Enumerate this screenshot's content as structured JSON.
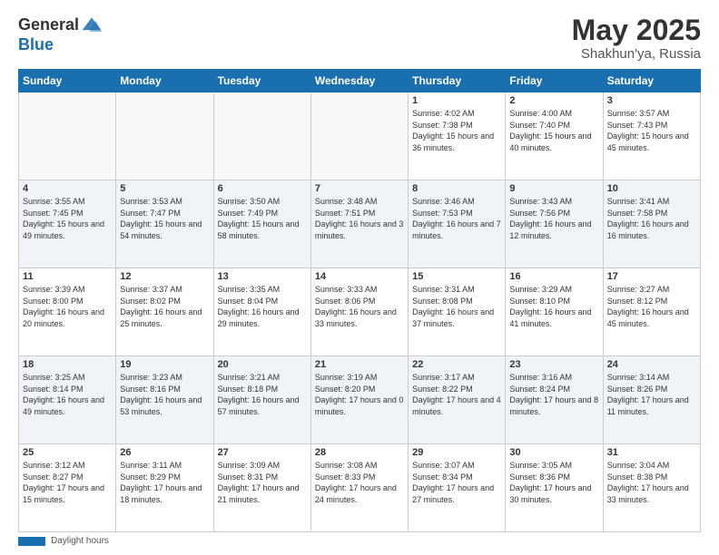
{
  "header": {
    "logo": {
      "general": "General",
      "blue": "Blue"
    },
    "title": "May 2025",
    "location": "Shakhun'ya, Russia"
  },
  "calendar": {
    "days_of_week": [
      "Sunday",
      "Monday",
      "Tuesday",
      "Wednesday",
      "Thursday",
      "Friday",
      "Saturday"
    ],
    "weeks": [
      [
        {
          "day": "",
          "sunrise": "",
          "sunset": "",
          "daylight": "",
          "empty": true
        },
        {
          "day": "",
          "sunrise": "",
          "sunset": "",
          "daylight": "",
          "empty": true
        },
        {
          "day": "",
          "sunrise": "",
          "sunset": "",
          "daylight": "",
          "empty": true
        },
        {
          "day": "",
          "sunrise": "",
          "sunset": "",
          "daylight": "",
          "empty": true
        },
        {
          "day": "1",
          "sunrise": "Sunrise: 4:02 AM",
          "sunset": "Sunset: 7:38 PM",
          "daylight": "Daylight: 15 hours and 36 minutes.",
          "empty": false
        },
        {
          "day": "2",
          "sunrise": "Sunrise: 4:00 AM",
          "sunset": "Sunset: 7:40 PM",
          "daylight": "Daylight: 15 hours and 40 minutes.",
          "empty": false
        },
        {
          "day": "3",
          "sunrise": "Sunrise: 3:57 AM",
          "sunset": "Sunset: 7:43 PM",
          "daylight": "Daylight: 15 hours and 45 minutes.",
          "empty": false
        }
      ],
      [
        {
          "day": "4",
          "sunrise": "Sunrise: 3:55 AM",
          "sunset": "Sunset: 7:45 PM",
          "daylight": "Daylight: 15 hours and 49 minutes.",
          "empty": false
        },
        {
          "day": "5",
          "sunrise": "Sunrise: 3:53 AM",
          "sunset": "Sunset: 7:47 PM",
          "daylight": "Daylight: 15 hours and 54 minutes.",
          "empty": false
        },
        {
          "day": "6",
          "sunrise": "Sunrise: 3:50 AM",
          "sunset": "Sunset: 7:49 PM",
          "daylight": "Daylight: 15 hours and 58 minutes.",
          "empty": false
        },
        {
          "day": "7",
          "sunrise": "Sunrise: 3:48 AM",
          "sunset": "Sunset: 7:51 PM",
          "daylight": "Daylight: 16 hours and 3 minutes.",
          "empty": false
        },
        {
          "day": "8",
          "sunrise": "Sunrise: 3:46 AM",
          "sunset": "Sunset: 7:53 PM",
          "daylight": "Daylight: 16 hours and 7 minutes.",
          "empty": false
        },
        {
          "day": "9",
          "sunrise": "Sunrise: 3:43 AM",
          "sunset": "Sunset: 7:56 PM",
          "daylight": "Daylight: 16 hours and 12 minutes.",
          "empty": false
        },
        {
          "day": "10",
          "sunrise": "Sunrise: 3:41 AM",
          "sunset": "Sunset: 7:58 PM",
          "daylight": "Daylight: 16 hours and 16 minutes.",
          "empty": false
        }
      ],
      [
        {
          "day": "11",
          "sunrise": "Sunrise: 3:39 AM",
          "sunset": "Sunset: 8:00 PM",
          "daylight": "Daylight: 16 hours and 20 minutes.",
          "empty": false
        },
        {
          "day": "12",
          "sunrise": "Sunrise: 3:37 AM",
          "sunset": "Sunset: 8:02 PM",
          "daylight": "Daylight: 16 hours and 25 minutes.",
          "empty": false
        },
        {
          "day": "13",
          "sunrise": "Sunrise: 3:35 AM",
          "sunset": "Sunset: 8:04 PM",
          "daylight": "Daylight: 16 hours and 29 minutes.",
          "empty": false
        },
        {
          "day": "14",
          "sunrise": "Sunrise: 3:33 AM",
          "sunset": "Sunset: 8:06 PM",
          "daylight": "Daylight: 16 hours and 33 minutes.",
          "empty": false
        },
        {
          "day": "15",
          "sunrise": "Sunrise: 3:31 AM",
          "sunset": "Sunset: 8:08 PM",
          "daylight": "Daylight: 16 hours and 37 minutes.",
          "empty": false
        },
        {
          "day": "16",
          "sunrise": "Sunrise: 3:29 AM",
          "sunset": "Sunset: 8:10 PM",
          "daylight": "Daylight: 16 hours and 41 minutes.",
          "empty": false
        },
        {
          "day": "17",
          "sunrise": "Sunrise: 3:27 AM",
          "sunset": "Sunset: 8:12 PM",
          "daylight": "Daylight: 16 hours and 45 minutes.",
          "empty": false
        }
      ],
      [
        {
          "day": "18",
          "sunrise": "Sunrise: 3:25 AM",
          "sunset": "Sunset: 8:14 PM",
          "daylight": "Daylight: 16 hours and 49 minutes.",
          "empty": false
        },
        {
          "day": "19",
          "sunrise": "Sunrise: 3:23 AM",
          "sunset": "Sunset: 8:16 PM",
          "daylight": "Daylight: 16 hours and 53 minutes.",
          "empty": false
        },
        {
          "day": "20",
          "sunrise": "Sunrise: 3:21 AM",
          "sunset": "Sunset: 8:18 PM",
          "daylight": "Daylight: 16 hours and 57 minutes.",
          "empty": false
        },
        {
          "day": "21",
          "sunrise": "Sunrise: 3:19 AM",
          "sunset": "Sunset: 8:20 PM",
          "daylight": "Daylight: 17 hours and 0 minutes.",
          "empty": false
        },
        {
          "day": "22",
          "sunrise": "Sunrise: 3:17 AM",
          "sunset": "Sunset: 8:22 PM",
          "daylight": "Daylight: 17 hours and 4 minutes.",
          "empty": false
        },
        {
          "day": "23",
          "sunrise": "Sunrise: 3:16 AM",
          "sunset": "Sunset: 8:24 PM",
          "daylight": "Daylight: 17 hours and 8 minutes.",
          "empty": false
        },
        {
          "day": "24",
          "sunrise": "Sunrise: 3:14 AM",
          "sunset": "Sunset: 8:26 PM",
          "daylight": "Daylight: 17 hours and 11 minutes.",
          "empty": false
        }
      ],
      [
        {
          "day": "25",
          "sunrise": "Sunrise: 3:12 AM",
          "sunset": "Sunset: 8:27 PM",
          "daylight": "Daylight: 17 hours and 15 minutes.",
          "empty": false
        },
        {
          "day": "26",
          "sunrise": "Sunrise: 3:11 AM",
          "sunset": "Sunset: 8:29 PM",
          "daylight": "Daylight: 17 hours and 18 minutes.",
          "empty": false
        },
        {
          "day": "27",
          "sunrise": "Sunrise: 3:09 AM",
          "sunset": "Sunset: 8:31 PM",
          "daylight": "Daylight: 17 hours and 21 minutes.",
          "empty": false
        },
        {
          "day": "28",
          "sunrise": "Sunrise: 3:08 AM",
          "sunset": "Sunset: 8:33 PM",
          "daylight": "Daylight: 17 hours and 24 minutes.",
          "empty": false
        },
        {
          "day": "29",
          "sunrise": "Sunrise: 3:07 AM",
          "sunset": "Sunset: 8:34 PM",
          "daylight": "Daylight: 17 hours and 27 minutes.",
          "empty": false
        },
        {
          "day": "30",
          "sunrise": "Sunrise: 3:05 AM",
          "sunset": "Sunset: 8:36 PM",
          "daylight": "Daylight: 17 hours and 30 minutes.",
          "empty": false
        },
        {
          "day": "31",
          "sunrise": "Sunrise: 3:04 AM",
          "sunset": "Sunset: 8:38 PM",
          "daylight": "Daylight: 17 hours and 33 minutes.",
          "empty": false
        }
      ]
    ]
  },
  "footer": {
    "label": "Daylight hours"
  }
}
